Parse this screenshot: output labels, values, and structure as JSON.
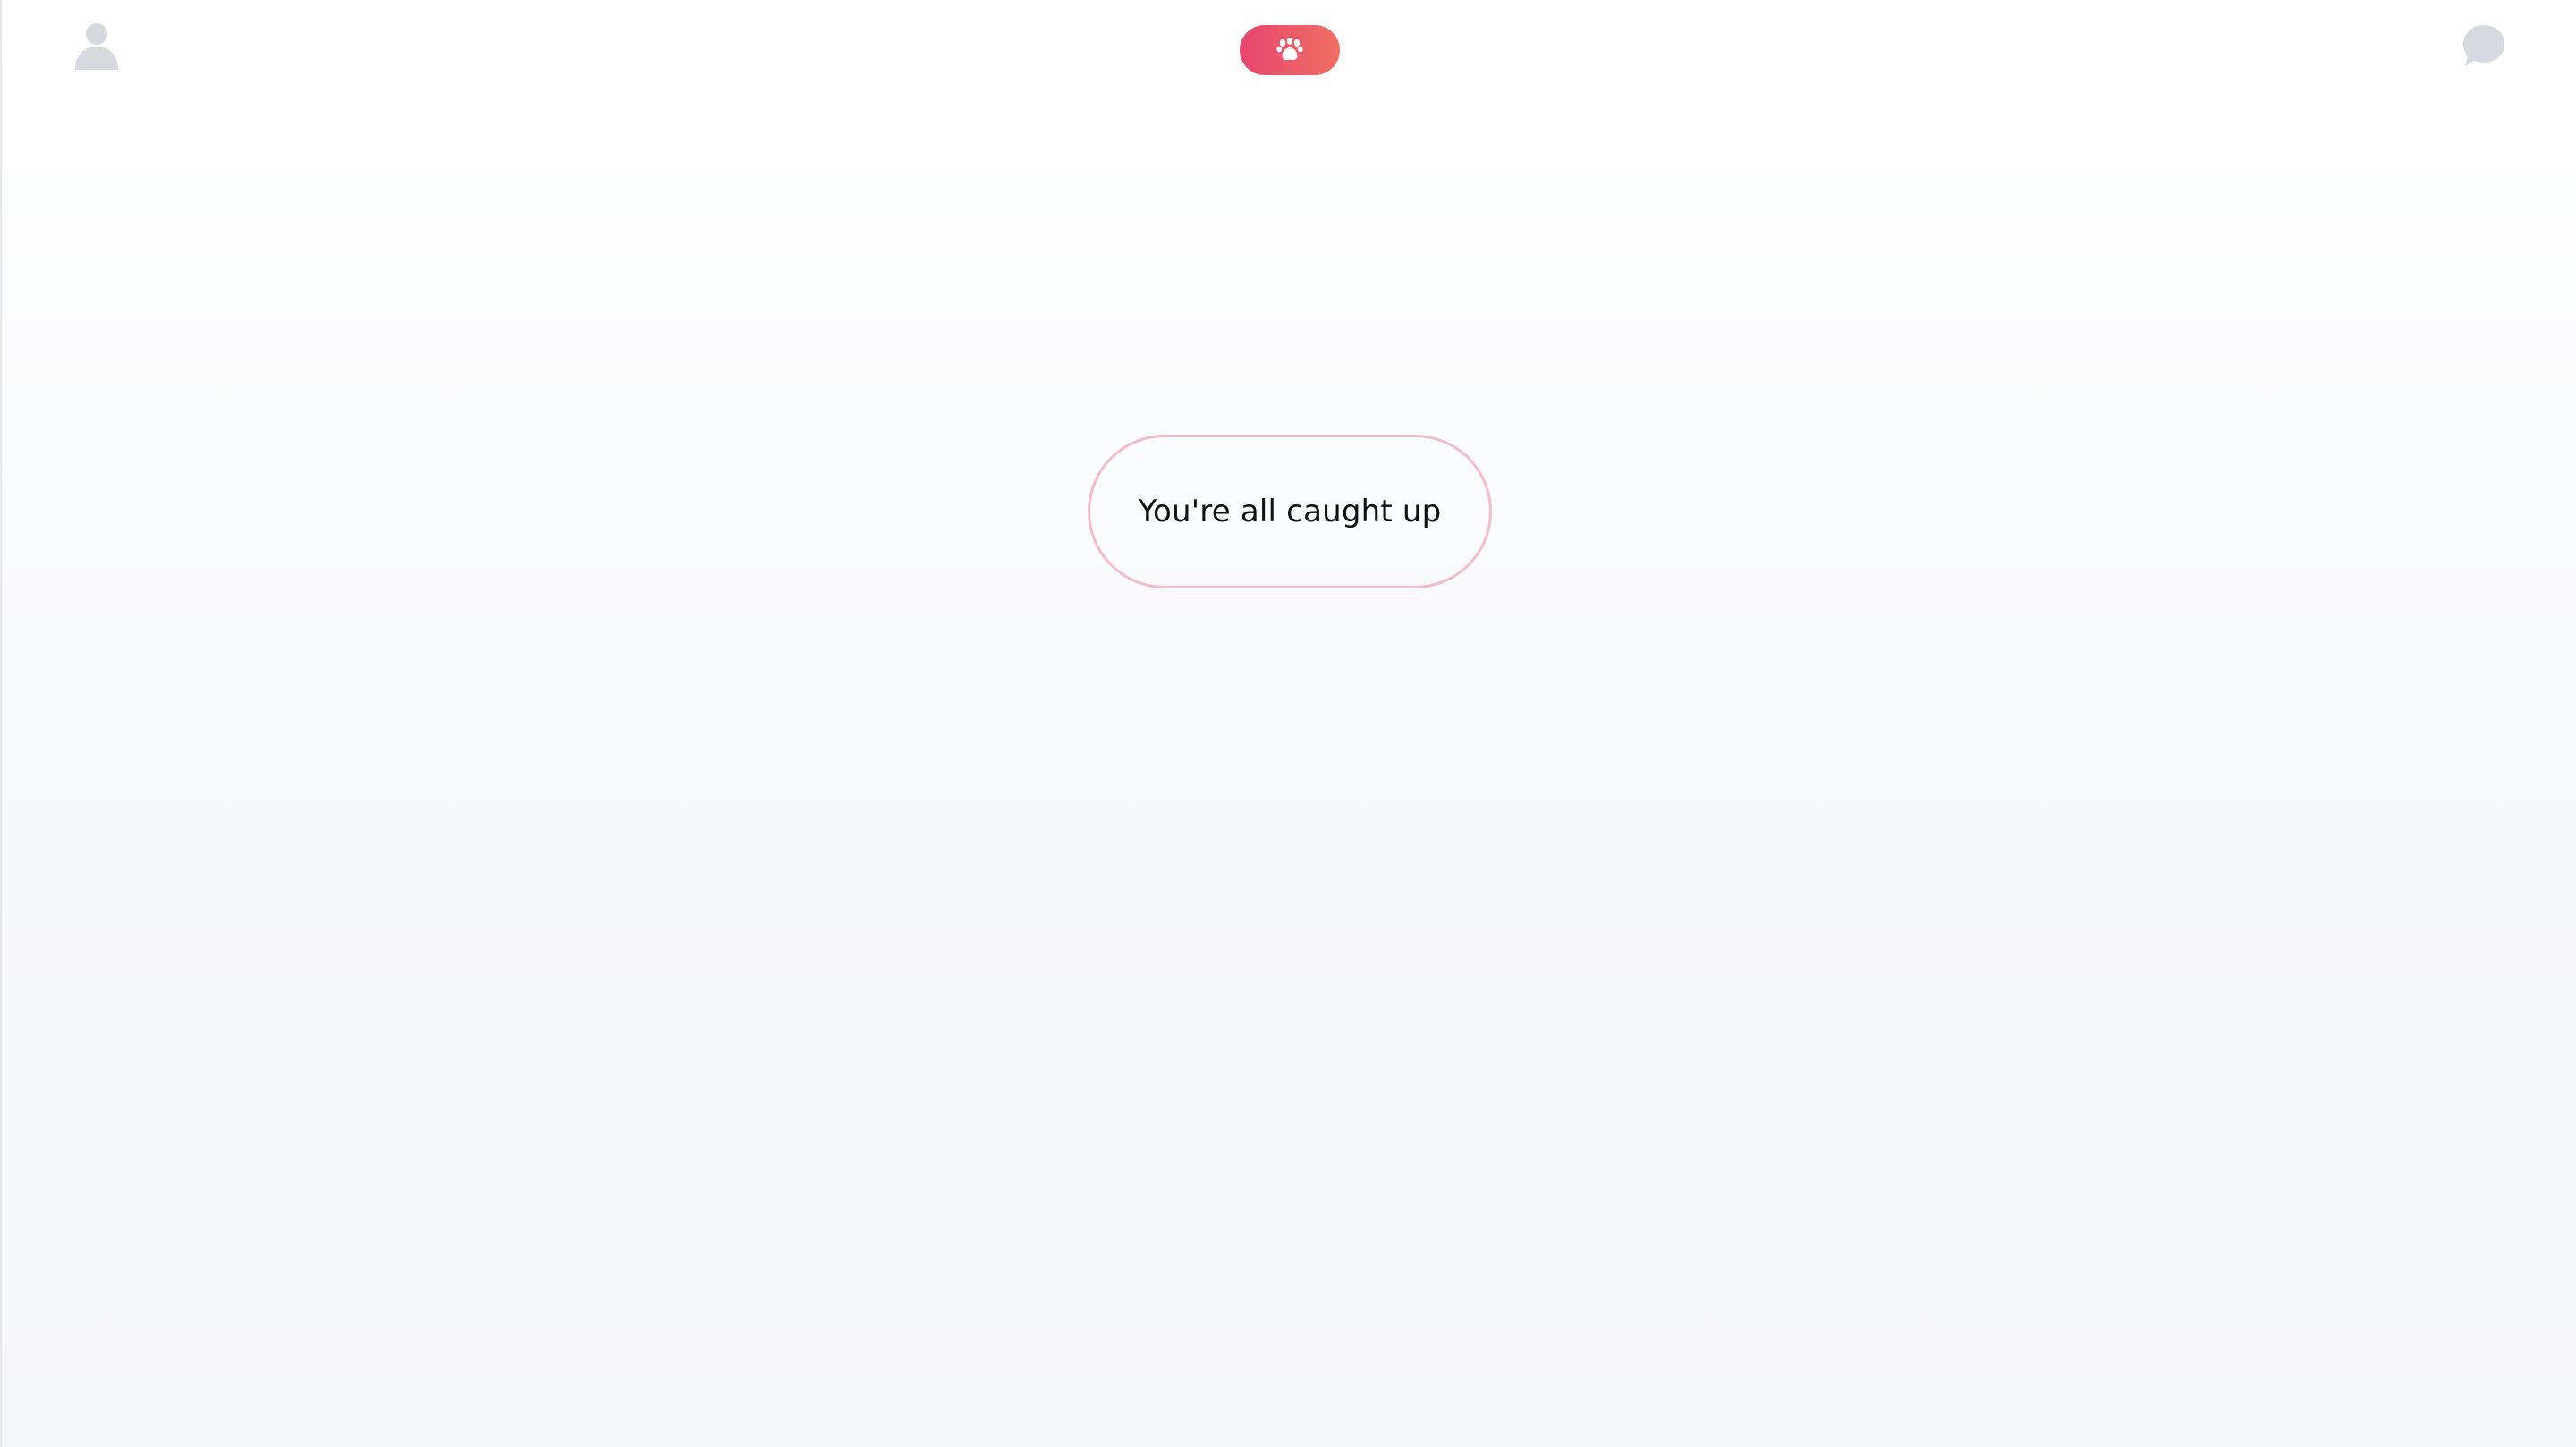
{
  "header": {
    "profile_icon": "user-icon",
    "logo_icon": "paw-icon",
    "messages_icon": "chat-bubble-icon"
  },
  "main": {
    "status_message": "You're all caught up"
  },
  "colors": {
    "brand_gradient_start": "#e7456e",
    "brand_gradient_end": "#ef6f63",
    "pill_border": "#f4bccb",
    "icon_gray": "#d6d9df",
    "background": "#f7f8fb"
  }
}
